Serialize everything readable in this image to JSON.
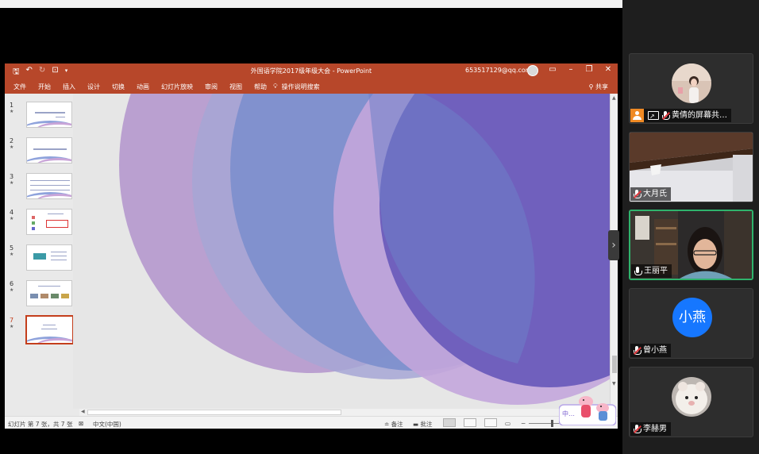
{
  "ppt": {
    "doc_title": "外国语学院2017级年级大会 - PowerPoint",
    "account": "653517129@qq.com",
    "qat": {
      "save_icon": "save-icon",
      "undo_icon": "undo-icon",
      "redo_icon": "redo-icon",
      "present_icon": "present-icon"
    },
    "window_buttons": {
      "ribbon_display": "▭",
      "minimize": "–",
      "restore": "❐",
      "close": "✕"
    },
    "ribbon_tabs": [
      "文件",
      "开始",
      "插入",
      "设计",
      "切换",
      "动画",
      "幻灯片放映",
      "审阅",
      "视图",
      "帮助"
    ],
    "tell_me": "操作说明搜索",
    "share": "共享",
    "slides": [
      {
        "num": "1",
        "star": "★"
      },
      {
        "num": "2",
        "star": "★"
      },
      {
        "num": "3",
        "star": "★"
      },
      {
        "num": "4",
        "star": "★"
      },
      {
        "num": "5",
        "star": "★"
      },
      {
        "num": "6",
        "star": "★"
      },
      {
        "num": "7",
        "star": "★"
      }
    ],
    "selected_slide": 7,
    "status": {
      "slide_info": "幻灯片 第 7 张，共 7 张",
      "language": "中文(中国)",
      "notes": "备注",
      "comments": "批注",
      "zoom_minus": "−"
    },
    "colors": {
      "ribbon": "#b7472a",
      "circle_left": "#b79ccf",
      "circle_mid": "#9aa7d4",
      "circle_blue": "#6f86c6",
      "circle_right": "#7062be"
    }
  },
  "participants": [
    {
      "name": "黄倩的屏幕共…",
      "muted": true,
      "host": true,
      "sharing": true,
      "type": "photo-avatar"
    },
    {
      "name": "大月氏",
      "muted": true,
      "type": "video"
    },
    {
      "name": "王丽平",
      "muted": false,
      "active": true,
      "type": "video"
    },
    {
      "name": "曾小燕",
      "muted": true,
      "type": "text-avatar",
      "avatar_text": "小燕",
      "avatar_color": "#1677ff"
    },
    {
      "name": "李赫男",
      "muted": true,
      "type": "photo-avatar"
    }
  ],
  "sticker_text": "中…"
}
